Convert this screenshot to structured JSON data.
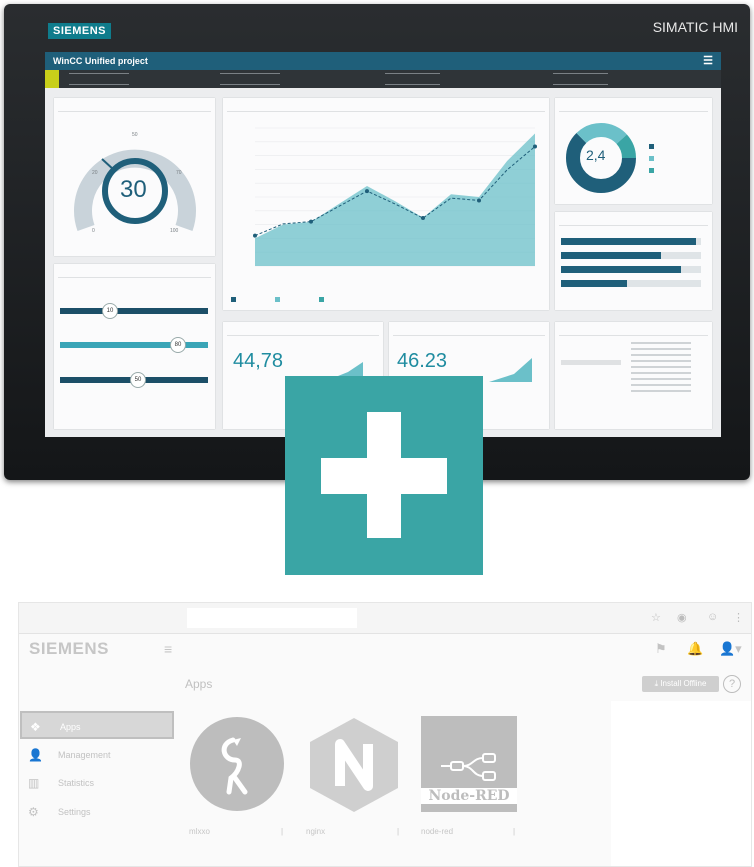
{
  "hmi": {
    "logo": "SIEMENS",
    "brand": "SIMATIC HMI",
    "screen": {
      "project_title": "WinCC Unified project",
      "gauge_value": "30",
      "gauge_ticks": [
        "0",
        "20",
        "50",
        "70",
        "100"
      ],
      "donut_value": "2,4",
      "value1": "44,78",
      "value2": "46.23",
      "slider_values": [
        "10",
        "80",
        "50"
      ],
      "chart_points": [
        2,
        3,
        3.2,
        4.5,
        5.8,
        4.7,
        3.5,
        5.2,
        5.0,
        7.6,
        9.6
      ]
    }
  },
  "edge": {
    "logo": "SIEMENS",
    "page_title": "Apps",
    "install_button": "Install Offline",
    "help": "?",
    "nav": [
      {
        "icon": "apps-icon",
        "label": "Apps",
        "glyph": "⚙"
      },
      {
        "icon": "management-icon",
        "label": "Management",
        "glyph": "👤"
      },
      {
        "icon": "statistics-icon",
        "label": "Statistics",
        "glyph": "▥"
      },
      {
        "icon": "settings-icon",
        "label": "Settings",
        "glyph": "⚙"
      }
    ],
    "apps": [
      {
        "name": "mlxxo",
        "icon": "flamingo-icon"
      },
      {
        "name": "nginx",
        "icon": "nginx-icon"
      },
      {
        "name": "node-red",
        "icon": "node-red-icon",
        "tile_text": "Node-RED"
      }
    ]
  },
  "colors": {
    "teal": "#3aa5a5",
    "hmi_header": "#1f5f7a"
  }
}
